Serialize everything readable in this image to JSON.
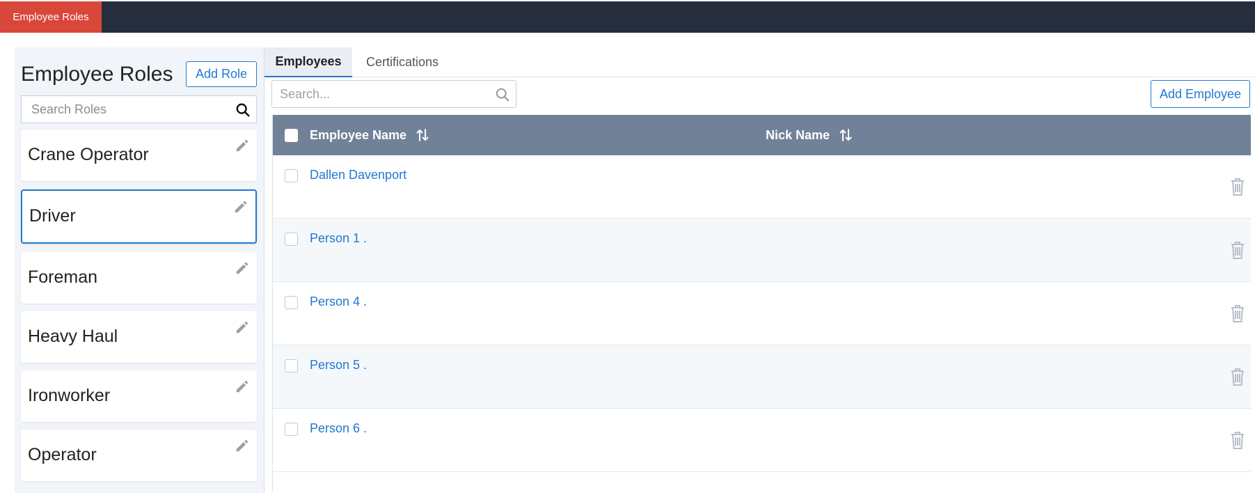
{
  "topbar": {
    "active_tab": "Employee Roles"
  },
  "roles_panel": {
    "title": "Employee Roles",
    "add_button": "Add Role",
    "search_placeholder": "Search Roles",
    "items": [
      {
        "label": "Crane Operator"
      },
      {
        "label": "Driver"
      },
      {
        "label": "Foreman"
      },
      {
        "label": "Heavy Haul"
      },
      {
        "label": "Ironworker"
      },
      {
        "label": "Operator"
      }
    ],
    "selected_index": 1
  },
  "tabs": [
    {
      "label": "Employees"
    },
    {
      "label": "Certifications"
    }
  ],
  "employees": {
    "search_placeholder": "Search...",
    "add_button": "Add Employee",
    "columns": {
      "name": "Employee Name",
      "nick": "Nick Name"
    },
    "rows": [
      {
        "name": "Dallen Davenport",
        "nick": ""
      },
      {
        "name": "Person 1 .",
        "nick": ""
      },
      {
        "name": "Person 4 .",
        "nick": ""
      },
      {
        "name": "Person 5 .",
        "nick": ""
      },
      {
        "name": "Person 6 .",
        "nick": ""
      }
    ]
  },
  "colors": {
    "accent": "#1f78d1",
    "topbar": "#262d3d",
    "active_tab": "#d9473a",
    "table_header": "#718198"
  },
  "icons": {
    "search": "search-icon",
    "edit": "pencil-icon",
    "sort": "sort-icon",
    "delete": "trash-icon"
  }
}
